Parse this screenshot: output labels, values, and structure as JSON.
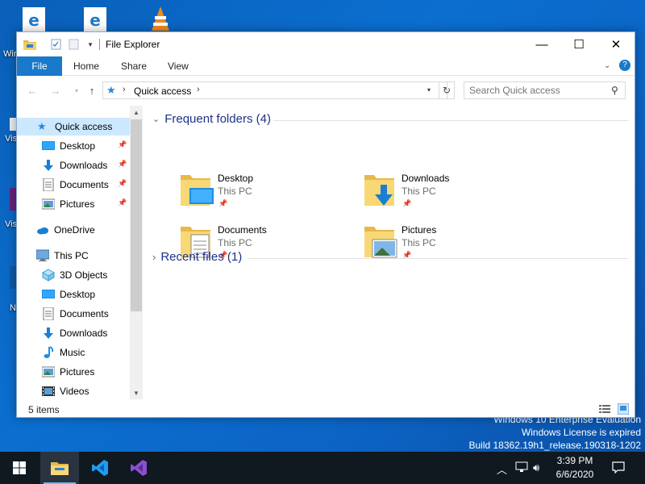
{
  "desktop": {
    "icon_labels": [
      "Win",
      "Vis",
      "Vis",
      "N"
    ],
    "watermark": [
      "Windows 10 Enterprise Evaluation",
      "Windows License is expired",
      "Build 18362.19h1_release.190318-1202"
    ]
  },
  "window": {
    "title": "File Explorer",
    "controls": {
      "minimize": "—",
      "maximize": "☐",
      "close": "✕"
    },
    "ribbon": {
      "tabs": [
        "File",
        "Home",
        "Share",
        "View"
      ]
    },
    "address": {
      "path": "Quick access",
      "search_placeholder": "Search Quick access"
    },
    "nav": {
      "quick_access": "Quick access",
      "pinned": [
        "Desktop",
        "Downloads",
        "Documents",
        "Pictures"
      ],
      "onedrive": "OneDrive",
      "this_pc": "This PC",
      "pc_items": [
        "3D Objects",
        "Desktop",
        "Documents",
        "Downloads",
        "Music",
        "Pictures",
        "Videos"
      ]
    },
    "content": {
      "frequent_header": "Frequent folders (4)",
      "recent_header": "Recent files (1)",
      "folders": [
        {
          "name": "Desktop",
          "location": "This PC"
        },
        {
          "name": "Downloads",
          "location": "This PC"
        },
        {
          "name": "Documents",
          "location": "This PC"
        },
        {
          "name": "Pictures",
          "location": "This PC"
        }
      ]
    },
    "status": {
      "items": "5 items"
    }
  },
  "taskbar": {
    "clock_time": "3:39 PM",
    "clock_date": "6/6/2020"
  },
  "colors": {
    "accent": "#1979ca",
    "selection": "#cce8ff",
    "header_text": "#1e3287",
    "taskbar": "#101820"
  }
}
